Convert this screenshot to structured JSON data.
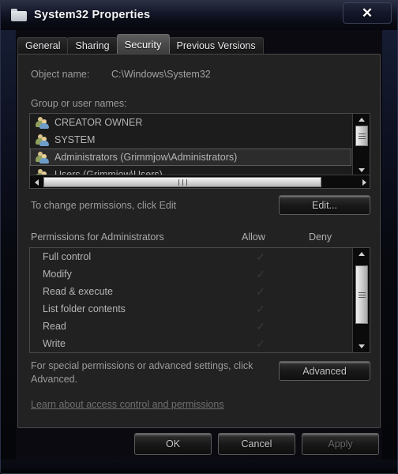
{
  "window": {
    "title": "System32 Properties",
    "folder_icon": "folder-icon",
    "close_label": "✕"
  },
  "tabs": [
    {
      "label": "General",
      "active": false
    },
    {
      "label": "Sharing",
      "active": false
    },
    {
      "label": "Security",
      "active": true
    },
    {
      "label": "Previous Versions",
      "active": false
    }
  ],
  "security": {
    "object_name_label": "Object name:",
    "object_name_value": "C:\\Windows\\System32",
    "group_names_label": "Group or user names:",
    "users": [
      {
        "name": "CREATOR OWNER",
        "selected": false
      },
      {
        "name": "SYSTEM",
        "selected": false
      },
      {
        "name": "Administrators (Grimmjow\\Administrators)",
        "selected": true
      },
      {
        "name": "Users (Grimmjow\\Users)",
        "selected": false
      }
    ],
    "change_permissions_text": "To change permissions, click Edit",
    "edit_button": "Edit...",
    "permissions_header": "Permissions for Administrators",
    "allow_column": "Allow",
    "deny_column": "Deny",
    "permissions": [
      {
        "name": "Full control",
        "allow": "✓",
        "deny": ""
      },
      {
        "name": "Modify",
        "allow": "✓",
        "deny": ""
      },
      {
        "name": "Read & execute",
        "allow": "✓",
        "deny": ""
      },
      {
        "name": "List folder contents",
        "allow": "✓",
        "deny": ""
      },
      {
        "name": "Read",
        "allow": "✓",
        "deny": ""
      },
      {
        "name": "Write",
        "allow": "✓",
        "deny": ""
      }
    ],
    "advanced_text": "For special permissions or advanced settings, click Advanced.",
    "advanced_button": "Advanced",
    "learn_link": "Learn about access control and permissions"
  },
  "dialog_buttons": {
    "ok": "OK",
    "cancel": "Cancel",
    "apply": "Apply"
  },
  "colors": {
    "panel_bg": "#222222",
    "window_chrome": "#15182a",
    "text": "#b5b5b5",
    "selection": "#2c2c2c",
    "scrollbar_thumb": "#d2d2d2"
  }
}
